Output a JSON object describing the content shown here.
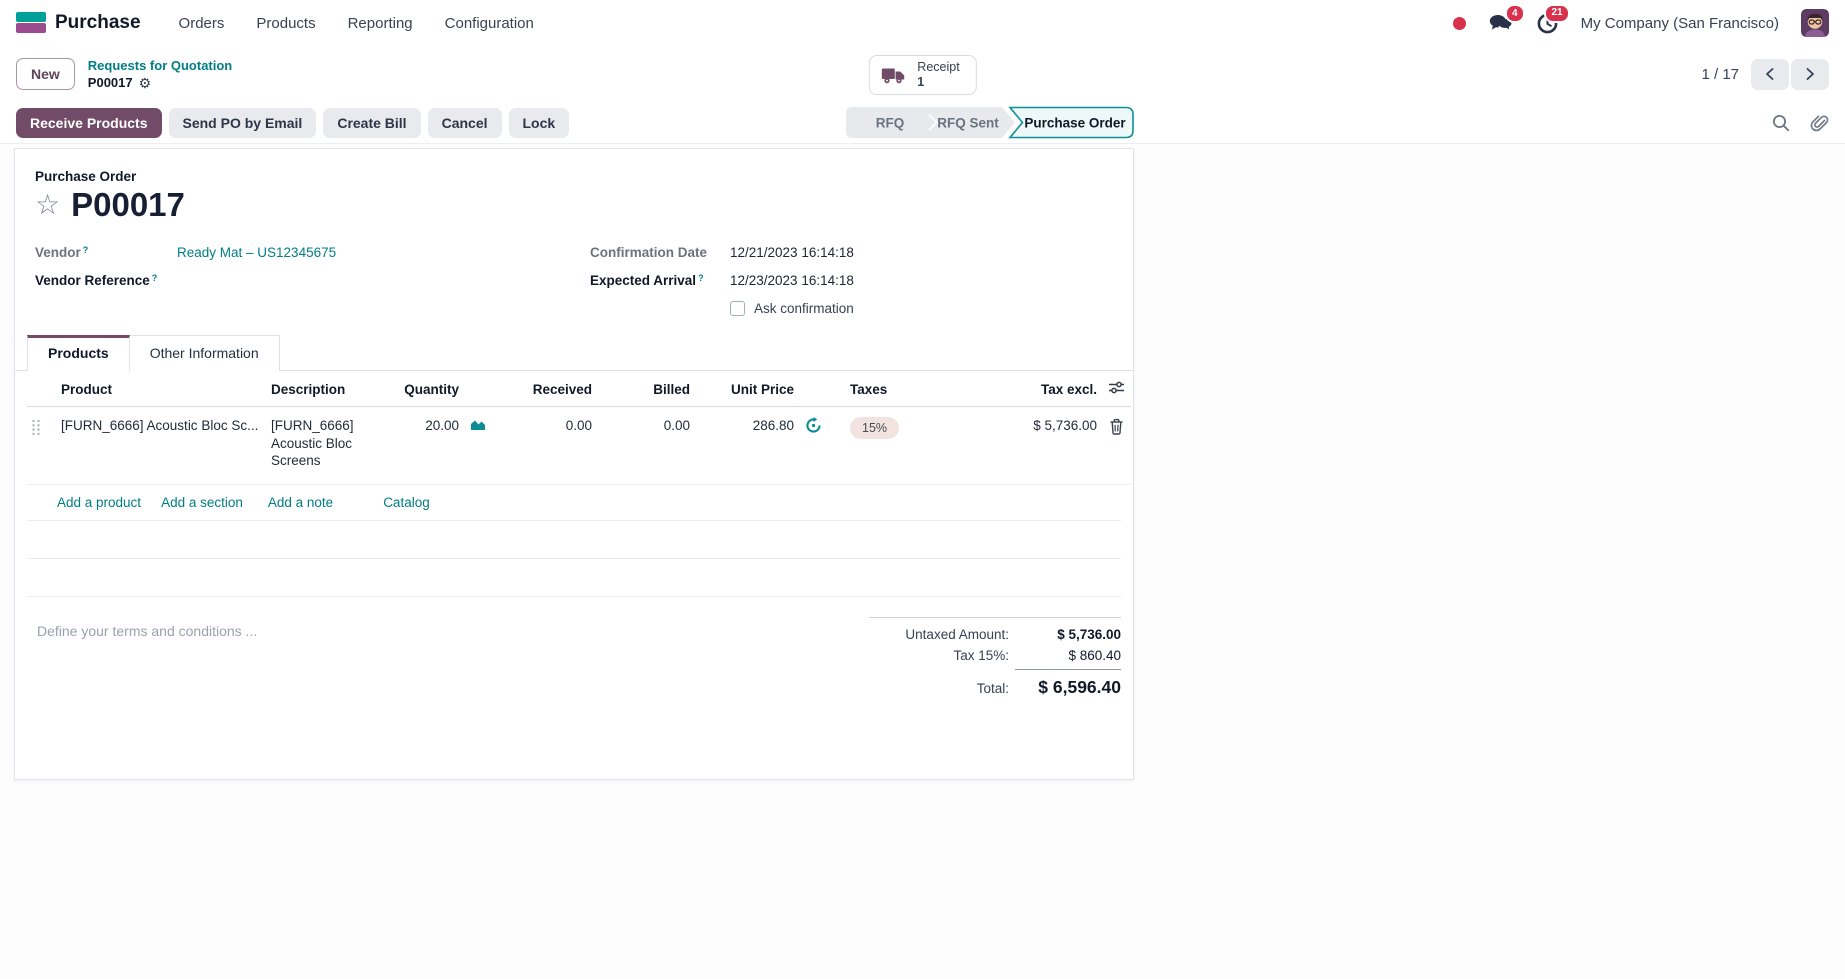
{
  "colors": {
    "primary": "#714B67",
    "link_teal": "#017E84",
    "danger_badge": "#D9304C",
    "step_active_border": "#0E8F96",
    "tax_pill_bg": "#F2E3E1"
  },
  "icons": {
    "gear": "⚙",
    "star": "☆"
  },
  "nav": {
    "app": "Purchase",
    "menus": [
      "Orders",
      "Products",
      "Reporting",
      "Configuration"
    ],
    "systray": {
      "messages_badge": "4",
      "activities_badge": "21",
      "company": "My Company (San Francisco)"
    }
  },
  "control_panel": {
    "new_label": "New",
    "breadcrumb_parent": "Requests for Quotation",
    "breadcrumb_current": "P00017",
    "stat_button": {
      "label": "Receipt",
      "value": "1"
    },
    "pager": "1 / 17"
  },
  "action_bar": {
    "buttons": [
      "Receive Products",
      "Send PO by Email",
      "Create Bill",
      "Cancel",
      "Lock"
    ],
    "steps": [
      "RFQ",
      "RFQ Sent",
      "Purchase Order"
    ],
    "active_step": "Purchase Order"
  },
  "sheet": {
    "doc_label": "Purchase Order",
    "title": "P00017",
    "help_marker": "?",
    "fields": {
      "vendor_label": "Vendor",
      "vendor_value": "Ready Mat – US12345675",
      "vendor_ref_label": "Vendor Reference",
      "confirmation_date_label": "Confirmation Date",
      "confirmation_date_value": "12/21/2023 16:14:18",
      "expected_arrival_label": "Expected Arrival",
      "expected_arrival_value": "12/23/2023 16:14:18",
      "ask_confirmation_label": "Ask confirmation"
    },
    "tabs": [
      "Products",
      "Other Information"
    ],
    "table": {
      "headers": [
        "Product",
        "Description",
        "Quantity",
        "Received",
        "Billed",
        "Unit Price",
        "Taxes",
        "Tax excl."
      ],
      "rows": [
        {
          "product": "[FURN_6666] Acoustic Bloc Sc...",
          "description": "[FURN_6666] Acoustic Bloc Screens",
          "quantity": "20.00",
          "received": "0.00",
          "billed": "0.00",
          "unit_price": "286.80",
          "taxes": "15%",
          "subtotal": "$ 5,736.00"
        }
      ],
      "footer_links": [
        "Add a product",
        "Add a section",
        "Add a note",
        "Catalog"
      ]
    },
    "terms_placeholder": "Define your terms and conditions ...",
    "totals": {
      "untaxed_label": "Untaxed Amount:",
      "untaxed_value": "$ 5,736.00",
      "tax_label": "Tax 15%:",
      "tax_value": "$ 860.40",
      "total_label": "Total:",
      "total_value": "$ 6,596.40"
    }
  }
}
